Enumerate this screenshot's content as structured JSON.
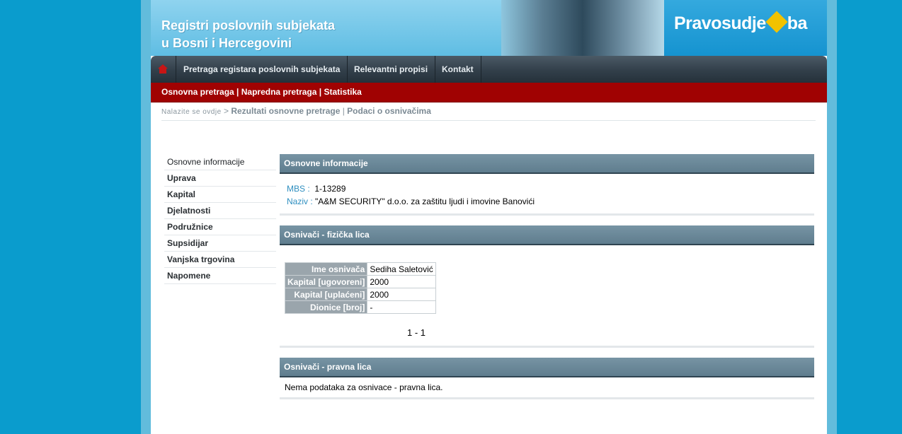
{
  "header": {
    "title_line1": "Registri poslovnih subjekata",
    "title_line2": "u Bosni i Hercegovini",
    "logo_left": "Pravosudje",
    "logo_right": "ba"
  },
  "nav": {
    "items": [
      {
        "label": "Pretraga registara poslovnih subjekata"
      },
      {
        "label": "Relevantni propisi"
      },
      {
        "label": "Kontakt"
      }
    ]
  },
  "subnav": {
    "basic": "Osnovna pretraga",
    "advanced": "Napredna pretraga",
    "stats": "Statistika",
    "separator": " | "
  },
  "breadcrumb": {
    "here": "Nalazite se ovdje",
    "arrow": " > ",
    "results": "Rezultati osnovne pretrage",
    "sep": " | ",
    "current": "Podaci o osnivačima"
  },
  "sidebar": {
    "items": [
      {
        "label": "Osnovne informacije"
      },
      {
        "label": "Uprava"
      },
      {
        "label": "Kapital"
      },
      {
        "label": "Djelatnosti"
      },
      {
        "label": "Podružnice"
      },
      {
        "label": "Supsidijar"
      },
      {
        "label": "Vanjska trgovina"
      },
      {
        "label": "Napomene"
      }
    ]
  },
  "basic_info": {
    "heading": "Osnovne informacije",
    "mbs_label": "MBS :",
    "mbs_value": "1-13289",
    "name_label": "Naziv :",
    "name_value": "\"A&M SECURITY\" d.o.o. za zaštitu ljudi i imovine Banovići"
  },
  "founders_natural": {
    "heading": "Osnivači - fizička lica",
    "rows": [
      {
        "label": "Ime osnivača",
        "value": "Sediha Saletović"
      },
      {
        "label": "Kapital [ugovoreni]",
        "value": "2000"
      },
      {
        "label": "Kapital [uplaćeni]",
        "value": "2000"
      },
      {
        "label": "Dionice [broj]",
        "value": "-"
      }
    ],
    "pager": "1 - 1"
  },
  "founders_legal": {
    "heading": "Osnivači - pravna lica",
    "empty_text": "Nema podataka za osnivace - pravna lica."
  },
  "colors": {
    "page_bg": "#0a9ccd",
    "nav_bg": "#323f4a",
    "subnav_bg": "#a00202",
    "section_header": "#6a8797",
    "label_blue": "#2f8fc0"
  }
}
